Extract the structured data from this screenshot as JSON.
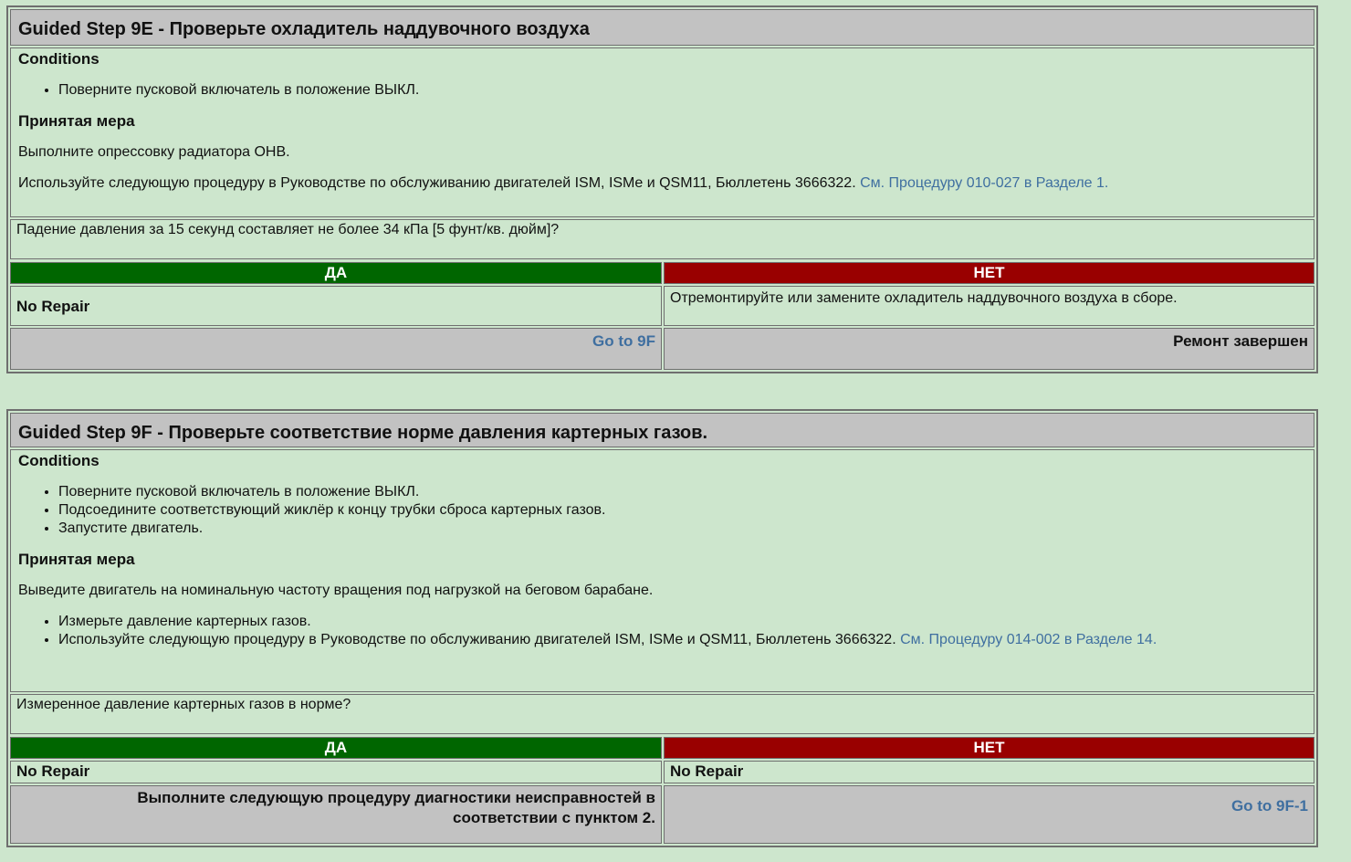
{
  "step_a": {
    "title": "Guided Step 9E - Проверьте охладитель наддувочного воздуха",
    "conditions_label": "Conditions",
    "conditions": [
      "Поверните пусковой включатель в положение ВЫКЛ."
    ],
    "action_label": "Принятая мера",
    "action_text": "Выполните опрессовку радиатора ОНВ.",
    "procedure_text": "Используйте следующую процедуру в Руководстве по обслуживанию двигателей ISM, ISMe и QSM11, Бюллетень 3666322. ",
    "procedure_link": "См. Процедуру 010-027 в Разделе 1.",
    "question": "Падение давления за 15 секунд составляет не более 34 кПа [5 фунт/кв. дюйм]?",
    "yes_label": "ДА",
    "no_label": "НЕТ",
    "yes_result": "No Repair",
    "no_result": "Отремонтируйте или замените охладитель наддувочного воздуха в сборе.",
    "yes_next": "Go to 9F",
    "no_next": "Ремонт завершен"
  },
  "step_b": {
    "title": "Guided Step 9F - Проверьте соответствие норме давления картерных газов.",
    "conditions_label": "Conditions",
    "conditions": [
      "Поверните пусковой включатель в положение ВЫКЛ.",
      "Подсоедините соответствующий жиклёр к концу трубки сброса картерных газов.",
      "Запустите двигатель."
    ],
    "action_label": "Принятая мера",
    "action_text": "Выведите двигатель на номинальную частоту вращения под нагрузкой на беговом барабане.",
    "action_bullets": [
      "Измерьте давление картерных газов."
    ],
    "procedure_text": "Используйте следующую процедуру в Руководстве по обслуживанию двигателей ISM, ISMe и QSM11, Бюллетень 3666322. ",
    "procedure_link": "См. Процедуру 014-002 в Разделе 14.",
    "question": "Измеренное давление картерных газов в норме?",
    "yes_label": "ДА",
    "no_label": "НЕТ",
    "yes_result": "No Repair",
    "no_result": "No Repair",
    "yes_next_line1": "Выполните следующую процедуру диагностики неисправностей в",
    "yes_next_line2": "соответствии с пунктом 2.",
    "no_next": "Go to 9F-1"
  },
  "colors": {
    "background": "#cde6cd",
    "header_gray": "#c2c2c2",
    "yes": "#006600",
    "no": "#990000",
    "link": "#3f6fa0"
  }
}
